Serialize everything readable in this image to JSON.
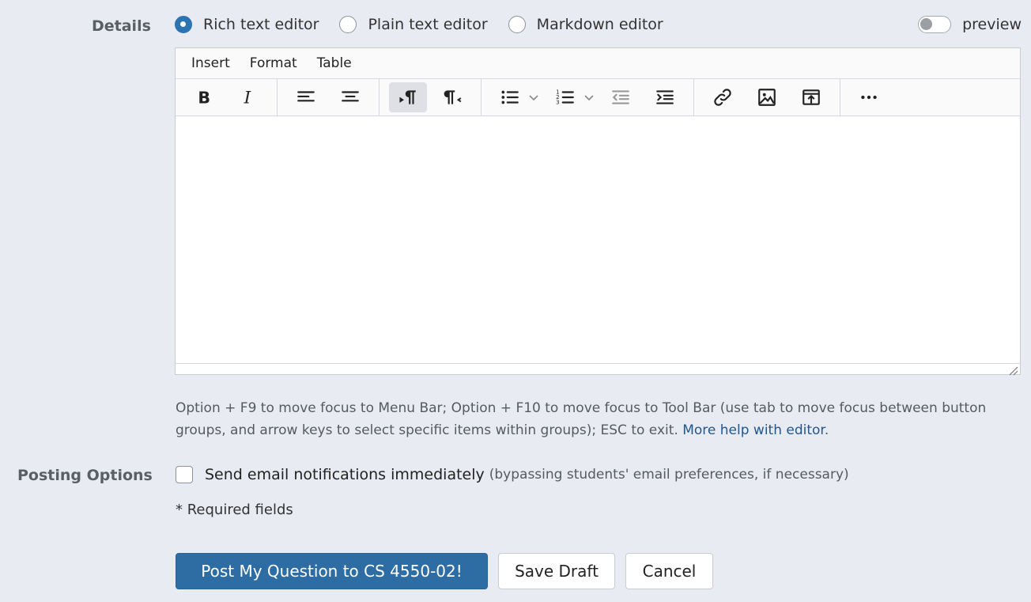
{
  "details_label": "Details",
  "editor_modes": [
    {
      "label": "Rich text editor",
      "selected": true
    },
    {
      "label": "Plain text editor",
      "selected": false
    },
    {
      "label": "Markdown editor",
      "selected": false
    }
  ],
  "preview": {
    "label": "preview",
    "on": false
  },
  "menubar": [
    "Insert",
    "Format",
    "Table"
  ],
  "toolbar": {
    "groups": [
      [
        "bold-icon",
        "italic-icon"
      ],
      [
        "align-left-icon",
        "align-center-icon"
      ],
      [
        "ltr-paragraph-icon",
        "rtl-paragraph-icon"
      ],
      [
        "bullet-list-icon",
        "numbered-list-icon",
        "outdent-icon",
        "indent-icon"
      ],
      [
        "link-icon",
        "image-icon",
        "upload-icon"
      ],
      [
        "more-icon"
      ]
    ],
    "active": "ltr-paragraph-icon"
  },
  "help": {
    "text": "Option + F9 to move focus to Menu Bar; Option + F10 to move focus to Tool Bar (use tab to move focus between button groups, and arrow keys to select specific items within groups); ESC to exit. ",
    "link": "More help with editor",
    "end": "."
  },
  "posting_options_label": "Posting Options",
  "email_option": {
    "main": "Send email notifications immediately",
    "sub": "(bypassing students' email preferences, if necessary)",
    "checked": false
  },
  "required_note": "* Required fields",
  "buttons": {
    "post": "Post My Question to CS 4550-02!",
    "save": "Save Draft",
    "cancel": "Cancel"
  },
  "colors": {
    "accent": "#2e6da4",
    "background": "#e9ebf2",
    "link": "#21578f"
  }
}
